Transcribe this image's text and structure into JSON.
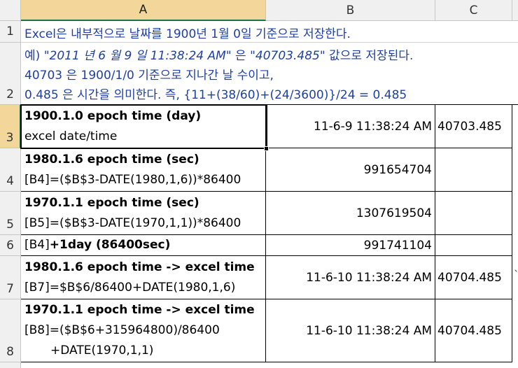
{
  "columns": [
    "A",
    "B",
    "C"
  ],
  "rows": [
    "1",
    "2",
    "3",
    "4",
    "5",
    "6",
    "7",
    "8"
  ],
  "r1": {
    "a": "Excel은 내부적으로 날짜를 1900년 1월 0일 기준으로 저장한다."
  },
  "r2": {
    "line1_prefix": "예) ",
    "line1_quote1": "\"2011 년 6 월 9 일 11:38:24 AM\"",
    "line1_mid": " 은 ",
    "line1_quote2": "\"40703.485\"",
    "line1_suffix": " 값으로 저장된다.",
    "line2": "40703 은 1900/1/0 기준으로 지나간 날 수이고,",
    "line3": "0.485 은 시간을 의미한다. 즉, {11+(38/60)+(24/3600)}/24 = 0.485"
  },
  "r3": {
    "a_line1": "1900.1.0 epoch time (day)",
    "a_line2": "excel date/time",
    "b": "11-6-9 11:38:24 AM",
    "c": "40703.485"
  },
  "r4": {
    "a_line1": "1980.1.6 epoch time (sec)",
    "a_line2": "[B4]=($B$3-DATE(1980,1,6))*86400",
    "b": "991654704"
  },
  "r5": {
    "a_line1": "1970.1.1 epoch time (sec)",
    "a_line2": "[B5]=($B$3-DATE(1970,1,1))*86400",
    "b": "1307619504"
  },
  "r6": {
    "a_prefix": "[B4]",
    "a_bold": "+1day (86400sec)",
    "b": "991741104"
  },
  "r7": {
    "a_line1": "1980.1.6 epoch time -> excel time",
    "a_line2": "[B7]=$B$6/86400+DATE(1980,1,6)",
    "b": "11-6-10 11:38:24 AM",
    "c": "40704.485",
    "d": "`"
  },
  "r8": {
    "a_line1": "1970.1.1 epoch time -> excel time",
    "a_line2": "[B8]=($B$6+315964800)/86400",
    "a_line3": "+DATE(1970,1,1)",
    "b": "11-6-10 11:38:24 AM",
    "c": "40704.485"
  }
}
